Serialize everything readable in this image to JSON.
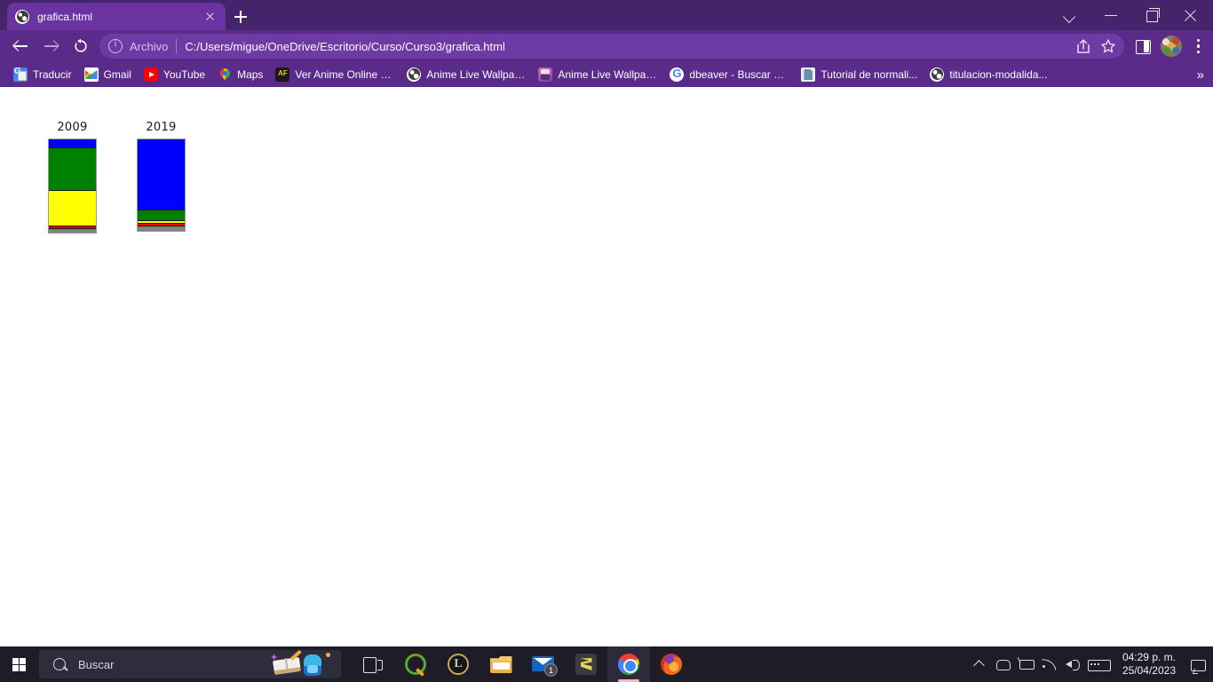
{
  "browser": {
    "tab": {
      "title": "grafica.html",
      "favicon": "globe-icon",
      "close_label": "",
      "new_tab_label": ""
    },
    "window_controls": {
      "chevron_label": "",
      "minimize_label": "",
      "maximize_label": "",
      "close_label": ""
    },
    "toolbar": {
      "back_label": "",
      "forward_label": "",
      "reload_label": "",
      "file_scheme_label": "Archivo",
      "url": "C:/Users/migue/OneDrive/Escritorio/Curso/Curso3/grafica.html",
      "share_label": "",
      "bookmark_star_label": "",
      "side_panel_label": "",
      "menu_label": ""
    },
    "bookmarks": {
      "overflow_label": "»",
      "items": [
        {
          "label": "Traducir",
          "icon": "translate-icon"
        },
        {
          "label": "Gmail",
          "icon": "gmail-icon"
        },
        {
          "label": "YouTube",
          "icon": "youtube-icon"
        },
        {
          "label": "Maps",
          "icon": "maps-icon"
        },
        {
          "label": "Ver Anime Online H...",
          "icon": "animeflv-icon"
        },
        {
          "label": "Anime Live Wallpap...",
          "icon": "globe-icon"
        },
        {
          "label": "Anime Live Wallpap...",
          "icon": "anime-app-icon"
        },
        {
          "label": "dbeaver - Buscar co...",
          "icon": "google-icon"
        },
        {
          "label": "Tutorial de normali...",
          "icon": "document-icon"
        },
        {
          "label": "titulacion-modalida...",
          "icon": "globe-icon"
        }
      ]
    }
  },
  "chart_data": {
    "type": "bar",
    "subtype": "stacked-bar",
    "title": "",
    "xlabel": "",
    "ylabel": "",
    "grid": false,
    "legend": false,
    "categories": [
      "2009",
      "2019"
    ],
    "colors": {
      "blue": "#0000ff",
      "green": "#008000",
      "yellow": "#ffff00",
      "red": "#ff0000",
      "gray": "#808080",
      "border": "#000000",
      "bar_outline": "#999999"
    },
    "series": [
      {
        "name": "blue",
        "color": "#0000ff",
        "values": [
          10,
          80
        ]
      },
      {
        "name": "green",
        "color": "#008000",
        "values": [
          48,
          12
        ]
      },
      {
        "name": "yellow",
        "color": "#ffff00",
        "values": [
          40,
          3
        ]
      },
      {
        "name": "red",
        "color": "#ff0000",
        "values": [
          3,
          3
        ]
      },
      {
        "name": "gray",
        "color": "#808080",
        "values": [
          4,
          5
        ]
      }
    ],
    "bars": [
      {
        "label": "2009",
        "total": 105,
        "segments": [
          {
            "name": "blue",
            "color": "#0000ff",
            "value": 10
          },
          {
            "name": "green",
            "color": "#008000",
            "value": 48
          },
          {
            "name": "yellow",
            "color": "#ffff00",
            "value": 40
          },
          {
            "name": "red",
            "color": "#ff0000",
            "value": 3
          },
          {
            "name": "gray",
            "color": "#808080",
            "value": 4
          }
        ]
      },
      {
        "label": "2019",
        "total": 103,
        "segments": [
          {
            "name": "blue",
            "color": "#0000ff",
            "value": 80
          },
          {
            "name": "green",
            "color": "#008000",
            "value": 12
          },
          {
            "name": "yellow",
            "color": "#ffff00",
            "value": 3
          },
          {
            "name": "red",
            "color": "#ff0000",
            "value": 3
          },
          {
            "name": "gray",
            "color": "#808080",
            "value": 5
          }
        ]
      }
    ]
  },
  "taskbar": {
    "start_label": "",
    "search": {
      "placeholder": "Buscar"
    },
    "apps": [
      {
        "name": "task-view",
        "label": ""
      },
      {
        "name": "qbittorrent",
        "label": ""
      },
      {
        "name": "league-of-legends",
        "label": ""
      },
      {
        "name": "file-explorer",
        "label": ""
      },
      {
        "name": "mail",
        "label": "",
        "badge": "1"
      },
      {
        "name": "sublime-text",
        "label": ""
      },
      {
        "name": "chrome",
        "label": "",
        "active": true
      },
      {
        "name": "firefox",
        "label": ""
      }
    ],
    "tray": {
      "chevron_label": "",
      "onedrive_label": "",
      "battery_label": "",
      "wifi_label": "",
      "volume_label": "",
      "keyboard_label": "",
      "time": "04:29 p. m.",
      "date": "25/04/2023",
      "notification_label": ""
    }
  }
}
